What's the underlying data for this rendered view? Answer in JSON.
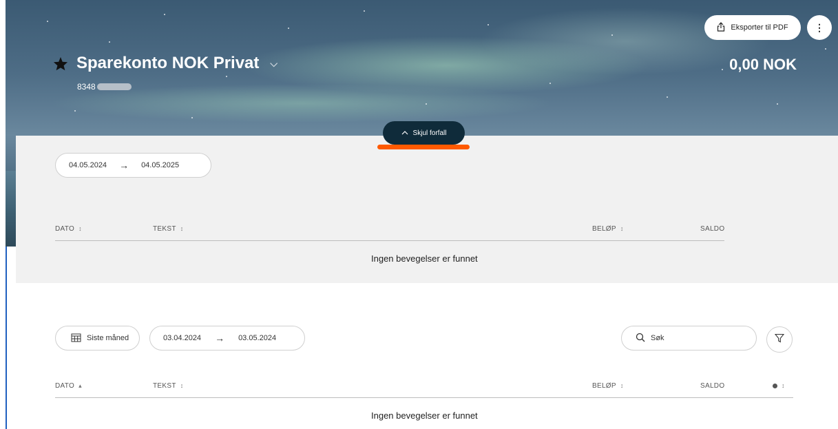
{
  "header": {
    "account_name": "Sparekonto NOK Privat",
    "account_number_prefix": "8348",
    "balance": "0,00 NOK",
    "export_label": "Eksporter til PDF",
    "more_label": "⋮"
  },
  "upcoming": {
    "toggle_label": "Skjul forfall",
    "date_from": "04.05.2024",
    "date_to": "04.05.2025",
    "columns": {
      "date": "DATO",
      "text": "TEKST",
      "amount": "BELØP",
      "balance": "SALDO"
    },
    "empty_text": "Ingen bevegelser er funnet"
  },
  "transactions": {
    "period_label": "Siste måned",
    "date_from": "03.04.2024",
    "date_to": "03.05.2024",
    "search_placeholder": "Søk",
    "columns": {
      "date": "DATO",
      "text": "TEKST",
      "amount": "BELØP",
      "balance": "SALDO"
    },
    "empty_text": "Ingen bevegelser er funnet"
  },
  "icons": {
    "favorite": "star-icon",
    "dropdown": "chevron-down-icon",
    "export": "share-export-icon",
    "more": "more-vertical-icon",
    "collapse": "chevron-up-icon",
    "calendar": "calendar-icon",
    "search": "search-icon",
    "filter": "filter-icon",
    "sort": "sort-icon"
  },
  "colors": {
    "accent_dark": "#0f2b3a",
    "highlight": "#ff5a00",
    "panel_bg": "#f1f1f1"
  }
}
